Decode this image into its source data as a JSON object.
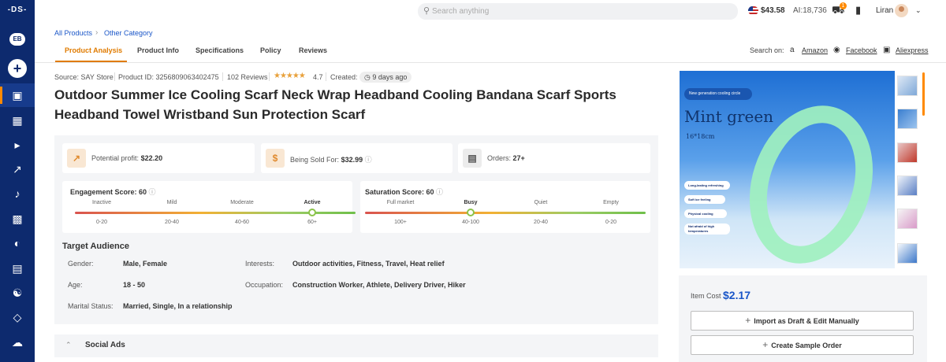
{
  "rail": {
    "logo": "-DS-",
    "eb_badge": "EB",
    "add_icon": "plus-icon",
    "items": [
      "box-icon",
      "store-icon",
      "megaphone-icon",
      "chart-icon",
      "tiktok-icon",
      "gift-icon",
      "gauge-icon",
      "document-icon",
      "users-icon",
      "package-icon",
      "cloud-icon"
    ]
  },
  "topbar": {
    "search_placeholder": "Search anything",
    "balance": "$43.58",
    "ai_credits": "AI:18,736",
    "cart_badge": "1",
    "user_name": "Liran"
  },
  "breadcrumb": {
    "items": [
      "All Products",
      "Other Category"
    ]
  },
  "tabs": [
    "Product Analysis",
    "Product Info",
    "Specifications",
    "Policy",
    "Reviews"
  ],
  "search_on": {
    "label": "Search on:",
    "links": [
      "Amazon",
      "Facebook",
      "Aliexpress"
    ]
  },
  "meta": {
    "source": "Source: SAY Store",
    "product_id": "Product ID: 3256809063402475",
    "reviews": "102 Reviews",
    "rating": "4.7",
    "created_label": "Created:",
    "created_value": "9 days ago"
  },
  "title": "Outdoor Summer Ice Cooling Scarf Neck Wrap Headband Cooling Bandana Scarf Sports Headband Towel Wristband Sun Protection Scarf",
  "stats": {
    "profit_label": "Potential profit:",
    "profit_value": "$22.20",
    "sold_label": "Being Sold For:",
    "sold_value": "$32.99",
    "orders_label": "Orders:",
    "orders_value": "27+"
  },
  "engagement": {
    "title": "Engagement Score: 60",
    "levels": [
      "Inactive",
      "Mild",
      "Moderate",
      "Active"
    ],
    "ranges": [
      "0-20",
      "20-40",
      "40-60",
      "60+"
    ]
  },
  "saturation": {
    "title": "Saturation Score: 60",
    "levels": [
      "Full market",
      "Busy",
      "Quiet",
      "Empty"
    ],
    "ranges": [
      "100+",
      "40-100",
      "20-40",
      "0-20"
    ]
  },
  "audience": {
    "title": "Target Audience",
    "gender_label": "Gender:",
    "gender_value": "Male, Female",
    "age_label": "Age:",
    "age_value": "18 - 50",
    "marital_label": "Marital Status:",
    "marital_value": "Married, Single, In a relationship",
    "interests_label": "Interests:",
    "interests_value": "Outdoor activities, Fitness, Travel, Heat relief",
    "occupation_label": "Occupation:",
    "occupation_value": "Construction Worker, Athlete, Delivery Driver, Hiker"
  },
  "social_ads": "Social Ads",
  "product_image": {
    "banner": "New generation cooling circle",
    "name": "Mint green",
    "size": "16*18cm",
    "features": [
      "Long-lasting refreshing",
      "Soft ice feeling",
      "Physical cooling",
      "Not afraid of high temperatures"
    ]
  },
  "cost": {
    "label": "Item Cost",
    "value": "$2.17",
    "import_button": "Import as Draft & Edit Manually",
    "sample_button": "Create Sample Order"
  }
}
